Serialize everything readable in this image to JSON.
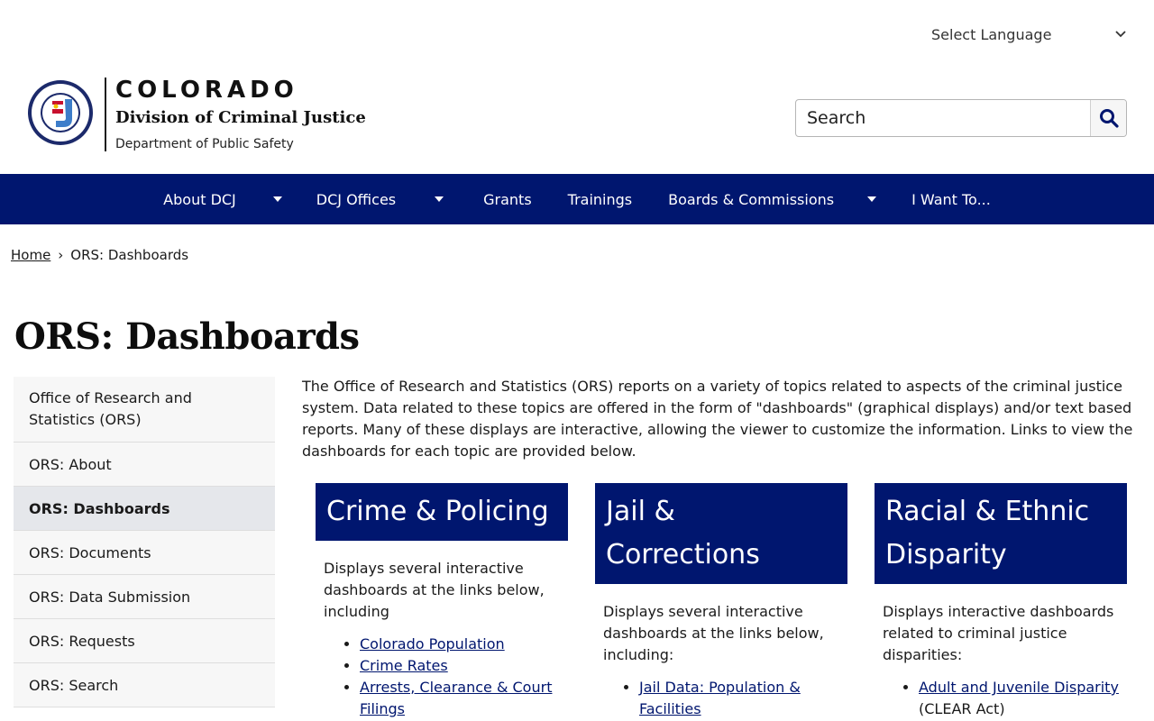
{
  "language": {
    "label": "Select Language"
  },
  "logo": {
    "state": "COLORADO",
    "division": "Division of Criminal Justice",
    "department": "Department of Public Safety"
  },
  "search": {
    "placeholder": "Search"
  },
  "nav": {
    "items": [
      {
        "label": "About DCJ",
        "has_dropdown": true
      },
      {
        "label": "DCJ Offices",
        "has_dropdown": true
      },
      {
        "label": "Grants",
        "has_dropdown": false
      },
      {
        "label": "Trainings",
        "has_dropdown": false
      },
      {
        "label": "Boards & Commissions",
        "has_dropdown": true
      },
      {
        "label": "I Want To...",
        "has_dropdown": false
      }
    ]
  },
  "breadcrumb": {
    "home": "Home",
    "separator": "›",
    "current": "ORS: Dashboards"
  },
  "page_title": "ORS: Dashboards",
  "sidebar": {
    "items": [
      {
        "label": "Office of Research and Statistics (ORS)",
        "active": false
      },
      {
        "label": "ORS: About",
        "active": false
      },
      {
        "label": "ORS: Dashboards",
        "active": true
      },
      {
        "label": "ORS: Documents",
        "active": false
      },
      {
        "label": "ORS: Data Submission",
        "active": false
      },
      {
        "label": "ORS: Requests",
        "active": false
      },
      {
        "label": "ORS: Search",
        "active": false
      }
    ]
  },
  "intro": "The Office of Research and Statistics (ORS) reports on a variety of topics related to aspects of the criminal justice system. Data related to these topics are offered in the form of \"dashboards\" (graphical displays) and/or text based reports. Many of these displays are interactive, allowing the viewer to customize the information. Links to view the dashboards for each topic are provided below.",
  "cards": [
    {
      "title": "Crime & Policing",
      "description": "Displays several interactive dashboards at the links below, including",
      "links": [
        {
          "text": "Colorado Population",
          "extra": ""
        },
        {
          "text": "Crime Rates",
          "extra": ""
        },
        {
          "text": "Arrests, Clearance & Court Filings",
          "extra": ""
        }
      ]
    },
    {
      "title": "Jail & Corrections",
      "description": "Displays several interactive dashboards at the links below, including:",
      "links": [
        {
          "text": "Jail Data: Population & Facilities",
          "extra": ""
        }
      ]
    },
    {
      "title": "Racial & Ethnic Disparity",
      "description": "Displays interactive dashboards related to criminal justice disparities:",
      "links": [
        {
          "text": "Adult and Juvenile Disparity",
          "extra": "(CLEAR Act)"
        }
      ]
    }
  ],
  "colors": {
    "brand_navy": "#00166f",
    "sidebar_bg": "#f7f7f7",
    "sidebar_active": "#e5e7eb"
  }
}
